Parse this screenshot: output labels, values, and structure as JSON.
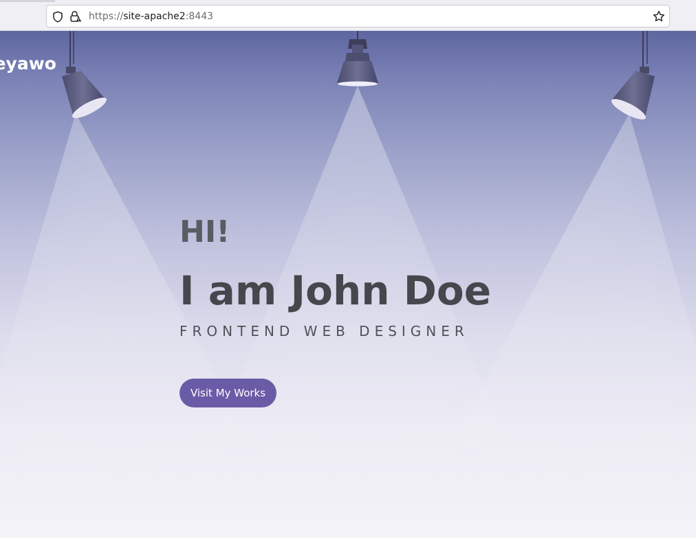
{
  "browser": {
    "url_scheme": "https://",
    "url_host": "site-apache2",
    "url_port": ":8443",
    "icons": {
      "tracking": "shield-icon",
      "security": "lock-warning-icon",
      "bookmark": "star-icon"
    }
  },
  "header": {
    "brand": "eyawo"
  },
  "hero": {
    "greeting": "HI!",
    "name": "I am John Doe",
    "subtitle": "FRONTEND WEB DESIGNER",
    "cta_label": "Visit My Works"
  },
  "colors": {
    "accent": "#6a5ba7",
    "heading": "#45474d",
    "background_top": "#5e66a0",
    "background_bottom": "#f4f3f8"
  }
}
